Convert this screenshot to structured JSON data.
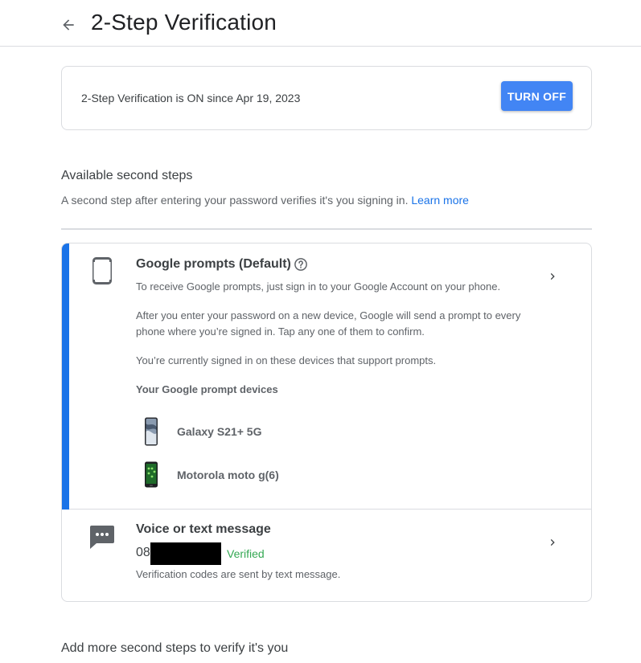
{
  "header": {
    "title": "2-Step Verification",
    "back_icon": "arrow-back-icon"
  },
  "status": {
    "text": "2-Step Verification is ON since Apr 19, 2023",
    "button_label": "TURN OFF",
    "button_color": "#4285f4"
  },
  "available": {
    "title": "Available second steps",
    "description": "A second step after entering your password verifies it's you signing in.",
    "learn_more": "Learn more"
  },
  "prompts": {
    "title": "Google prompts (Default)",
    "line1": "To receive Google prompts, just sign in to your Google Account on your phone.",
    "line2": "After you enter your password on a new device, Google will send a prompt to every phone where you’re signed in. Tap any one of them to confirm.",
    "line3": "You’re currently signed in on these devices that support prompts.",
    "devices_heading": "Your Google prompt devices",
    "devices": [
      {
        "name": "Galaxy S21+ 5G"
      },
      {
        "name": "Motorola moto g(6)"
      }
    ],
    "accent_color": "#1a73e8"
  },
  "sms": {
    "title": "Voice or text message",
    "phone_prefix": "08",
    "verified": "Verified",
    "description": "Verification codes are sent by text message.",
    "verified_color": "#34a853"
  },
  "more": {
    "title": "Add more second steps to verify it's you"
  }
}
